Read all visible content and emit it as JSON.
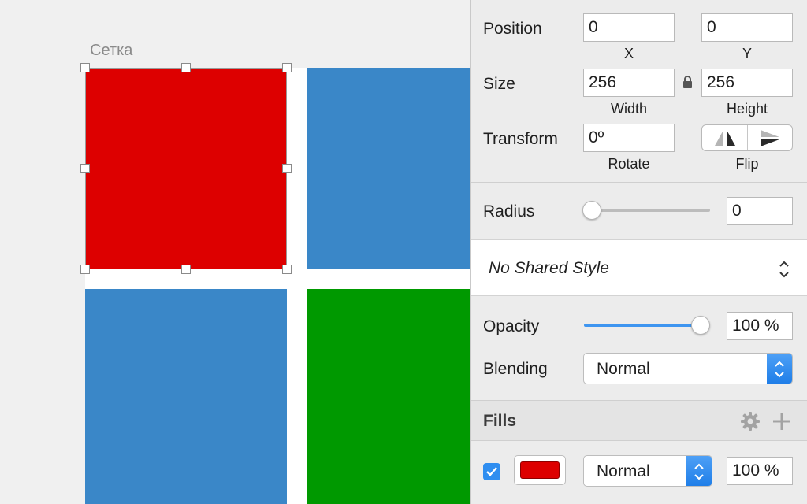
{
  "canvas": {
    "artboard_title": "Сетка",
    "background": "#f0f0f0",
    "artboard_background": "#ffffff",
    "squares": [
      {
        "name": "red-square",
        "color": "#dd0000",
        "selected": true
      },
      {
        "name": "blue-square-top-right",
        "color": "#3a87c8"
      },
      {
        "name": "blue-square-bottom-left",
        "color": "#3a87c8"
      },
      {
        "name": "green-square",
        "color": "#009900"
      }
    ]
  },
  "inspector": {
    "position": {
      "label": "Position",
      "x_value": "0",
      "x_label": "X",
      "y_value": "0",
      "y_label": "Y"
    },
    "size": {
      "label": "Size",
      "width_value": "256",
      "width_label": "Width",
      "height_value": "256",
      "height_label": "Height",
      "lock_icon": "unlocked-lock-icon"
    },
    "transform": {
      "label": "Transform",
      "rotate_value": "0º",
      "rotate_label": "Rotate",
      "flip_label": "Flip",
      "flip_icons": [
        "flip-horizontal-icon",
        "flip-vertical-icon"
      ]
    },
    "radius": {
      "label": "Radius",
      "value": "0",
      "slider_fraction": 0.0
    },
    "shared_style": {
      "value": "No Shared Style",
      "icon": "up-down-chevron-icon"
    },
    "opacity": {
      "label": "Opacity",
      "value": "100 %",
      "slider_fraction": 1.0
    },
    "blending": {
      "label": "Blending",
      "value": "Normal"
    },
    "fills": {
      "title": "Fills",
      "icons": [
        "gear-icon",
        "plus-icon"
      ],
      "items": [
        {
          "enabled": true,
          "color": "#dd0000",
          "blend_mode": "Normal",
          "opacity": "100 %"
        }
      ]
    },
    "accent_color": "#2f8ef0"
  }
}
